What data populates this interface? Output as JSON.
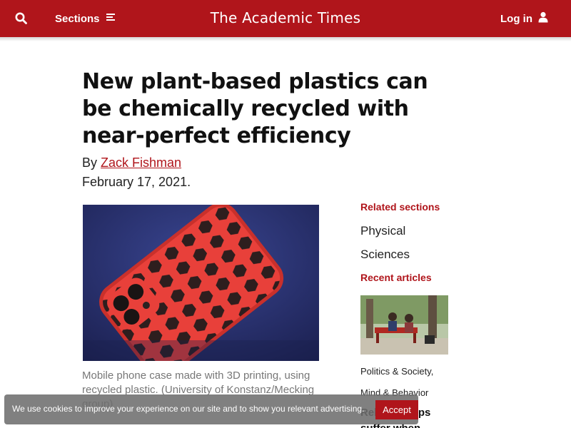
{
  "header": {
    "sections_label": "Sections",
    "brand": "The Academic Times",
    "login_label": "Log in",
    "bg_color": "#b0151b",
    "icons": [
      "search-icon",
      "menu-icon",
      "user-icon"
    ]
  },
  "article": {
    "headline": "New plant-based plastics can be chemically recycled with near-perfect efficiency",
    "by_prefix": "By",
    "author": "Zack Fishman",
    "date": "February 17, 2021.",
    "image_caption": "Mobile phone case made with 3D printing, using recycled plastic. (University of Konstanz/Mecking group)"
  },
  "sidebar": {
    "related_heading": "Related sections",
    "related_items": [
      "Physical",
      "Sciences"
    ],
    "recent_heading": "Recent articles",
    "recent_tags": [
      "Politics & Society,",
      "Mind & Behavior"
    ],
    "recent_title": "Relationships suffer when"
  },
  "cookie_banner": {
    "message": "We use cookies to improve your experience on our site and to show you relevant advertising.",
    "accept_label": "Accept"
  }
}
